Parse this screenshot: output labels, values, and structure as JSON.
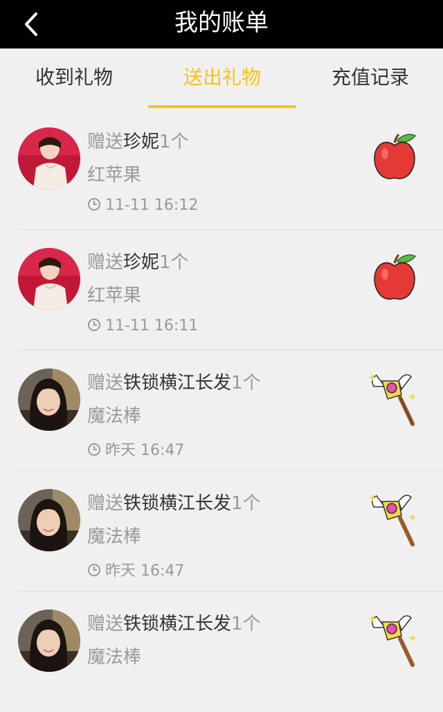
{
  "header": {
    "title": "我的账单",
    "back_icon": "chevron-left-icon"
  },
  "tabs": [
    {
      "label": "收到礼物",
      "active": false
    },
    {
      "label": "送出礼物",
      "active": true
    },
    {
      "label": "充值记录",
      "active": false
    }
  ],
  "colors": {
    "accent": "#f5c518",
    "header_bg": "#000000",
    "page_bg": "#f0f0f0",
    "muted_text": "#999999",
    "name_text": "#333333"
  },
  "records": [
    {
      "prefix": "赠送",
      "recipient": "珍妮",
      "suffix": "1个",
      "gift": "红苹果",
      "time": "11-11 16:12",
      "gift_icon": "red-apple-icon",
      "avatar": "avatar-red"
    },
    {
      "prefix": "赠送",
      "recipient": "珍妮",
      "suffix": "1个",
      "gift": "红苹果",
      "time": "11-11 16:11",
      "gift_icon": "red-apple-icon",
      "avatar": "avatar-red"
    },
    {
      "prefix": "赠送",
      "recipient": "铁锁横江长发",
      "suffix": "1个",
      "gift": "魔法棒",
      "time": "昨天 16:47",
      "gift_icon": "magic-wand-icon",
      "avatar": "avatar-dark"
    },
    {
      "prefix": "赠送",
      "recipient": "铁锁横江长发",
      "suffix": "1个",
      "gift": "魔法棒",
      "time": "昨天 16:47",
      "gift_icon": "magic-wand-icon",
      "avatar": "avatar-dark"
    },
    {
      "prefix": "赠送",
      "recipient": "铁锁横江长发",
      "suffix": "1个",
      "gift": "魔法棒",
      "time": "",
      "gift_icon": "magic-wand-icon",
      "avatar": "avatar-dark"
    }
  ]
}
